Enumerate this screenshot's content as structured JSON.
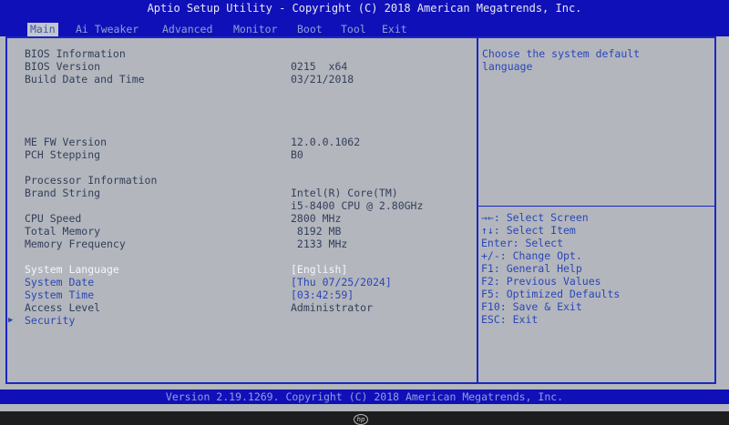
{
  "title_bar": "Aptio Setup Utility - Copyright (C) 2018 American Megatrends, Inc.",
  "menu": [
    {
      "label": "Main",
      "active": true
    },
    {
      "label": "Ai Tweaker"
    },
    {
      "label": "Advanced"
    },
    {
      "label": "Monitor"
    },
    {
      "label": "Boot"
    },
    {
      "label": "Tool"
    },
    {
      "label": "Exit"
    }
  ],
  "main": {
    "bios_info_header": "BIOS Information",
    "bios_version_label": "BIOS Version",
    "bios_version_value": "0215  x64",
    "build_date_label": "Build Date and Time",
    "build_date_value": "03/21/2018",
    "me_fw_label": "ME FW Version",
    "me_fw_value": "12.0.0.1062",
    "pch_label": "PCH Stepping",
    "pch_value": "B0",
    "processor_header": "Processor Information",
    "brand_label": "Brand String",
    "brand_value_1": "Intel(R) Core(TM)",
    "brand_value_2": "i5-8400 CPU @ 2.80GHz",
    "cpu_speed_label": "CPU Speed",
    "cpu_speed_value": "2800 MHz",
    "total_memory_label": "Total Memory",
    "total_memory_value": " 8192 MB",
    "memory_freq_label": "Memory Frequency",
    "memory_freq_value": " 2133 MHz",
    "system_language_label": "System Language",
    "system_language_value": "[English]",
    "system_date_label": "System Date",
    "system_date_value": "[Thu 07/25/2024]",
    "system_time_label": "System Time",
    "system_time_value": "[03:42:59]",
    "access_level_label": "Access Level",
    "access_level_value": "Administrator",
    "security_label": "Security"
  },
  "help": {
    "line1": "Choose the system default",
    "line2": "language"
  },
  "keys": [
    "→←: Select Screen",
    "↑↓: Select Item",
    "Enter: Select",
    "+/-: Change Opt.",
    "F1: General Help",
    "F2: Previous Values",
    "F5: Optimized Defaults",
    "F10: Save & Exit",
    "ESC: Exit"
  ],
  "status_bar": "Version 2.19.1269. Copyright (C) 2018 American Megatrends, Inc.",
  "bezel_logo": "hp",
  "colors": {
    "bios_blue": "#1010b8",
    "panel_gray": "#b3b6bd",
    "link_blue": "#2a46b8",
    "selected_white": "#f4f6fb"
  }
}
